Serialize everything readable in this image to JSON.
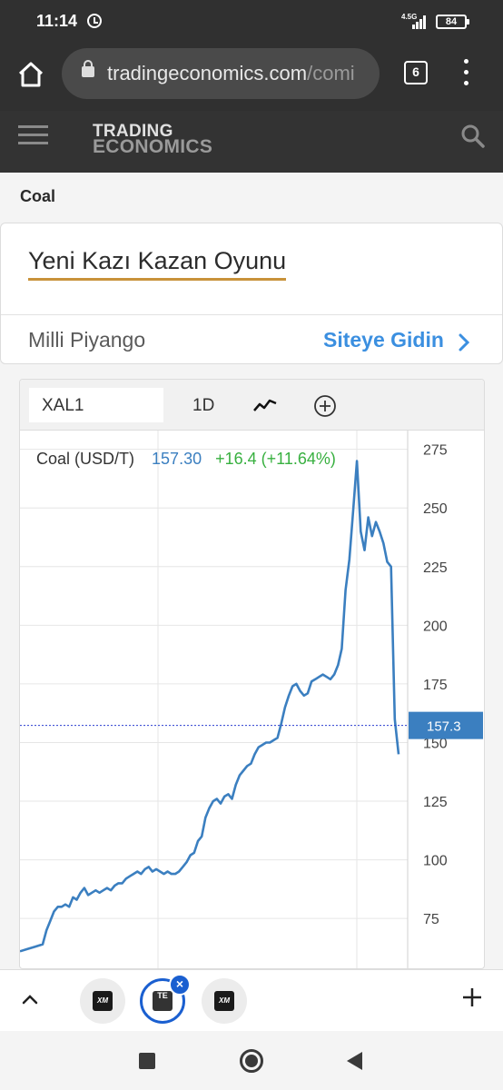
{
  "status_bar": {
    "time": "11:14",
    "network_type": "4.5G",
    "battery_level": "84",
    "icons": [
      "alarm-icon",
      "signal-icon",
      "battery-icon"
    ]
  },
  "browser": {
    "url_main": "tradingeconomics.com",
    "url_rest": "/comi",
    "tab_count": "6",
    "icons": [
      "home-icon",
      "lock-icon",
      "more-vert-icon"
    ]
  },
  "site_header": {
    "logo_line1": "TRADING",
    "logo_line2": "ECONOMICS",
    "icons": [
      "hamburger-icon",
      "search-icon"
    ]
  },
  "page": {
    "title": "Coal"
  },
  "ad": {
    "headline": "Yeni Kazı Kazan Oyunu",
    "advertiser": "Milli Piyango",
    "cta": "Siteye Gidin",
    "accent_color": "#c8923a",
    "cta_color": "#3b8fe0"
  },
  "chart_toolbar": {
    "symbol": "XAL1",
    "interval": "1D",
    "icons": [
      "line-chart-icon",
      "add-indicator-icon"
    ]
  },
  "chart_data": {
    "type": "line",
    "legend_name": "Coal (USD/T)",
    "last_value": "157.30",
    "change": "+16.4 (+11.64%)",
    "current_price_label": "157.3",
    "current_price": 157.3,
    "y_ticks": [
      "275",
      "250",
      "225",
      "200",
      "175",
      "150",
      "125",
      "100",
      "75"
    ],
    "ylim": [
      53,
      283
    ],
    "x": [
      0,
      2,
      4,
      6,
      7,
      8,
      9,
      10,
      11,
      12,
      13,
      14,
      15,
      16,
      17,
      18,
      19,
      20,
      21,
      22,
      23,
      24,
      25,
      26,
      27,
      28,
      29,
      30,
      31,
      32,
      33,
      34,
      35,
      36,
      37,
      38,
      39,
      40,
      41,
      42,
      43,
      44,
      45,
      46,
      47,
      48,
      49,
      50,
      51,
      52,
      53,
      54,
      55,
      56,
      57,
      58,
      59,
      60,
      61,
      62,
      63,
      64,
      65,
      66,
      67,
      68,
      69,
      70,
      71,
      72,
      73,
      74,
      75,
      76,
      77,
      78,
      79,
      80,
      81,
      82,
      83,
      84,
      85,
      86,
      87,
      88,
      89,
      90,
      91,
      92,
      93,
      94,
      95,
      96,
      97,
      98,
      99,
      100
    ],
    "values": [
      61,
      62,
      63,
      64,
      70,
      74,
      78,
      80,
      80,
      81,
      80,
      84,
      83,
      86,
      88,
      85,
      86,
      87,
      86,
      87,
      88,
      87,
      89,
      90,
      90,
      92,
      93,
      94,
      95,
      94,
      96,
      97,
      95,
      96,
      95,
      94,
      95,
      94,
      94,
      95,
      97,
      99,
      102,
      103,
      108,
      110,
      118,
      122,
      125,
      126,
      124,
      127,
      128,
      126,
      132,
      136,
      138,
      140,
      141,
      145,
      148,
      149,
      150,
      150,
      151,
      152,
      158,
      165,
      170,
      174,
      175,
      172,
      170,
      171,
      176,
      177,
      178,
      179,
      178,
      177,
      179,
      183,
      190,
      215,
      228,
      249,
      270,
      240,
      232,
      246,
      238,
      244,
      240,
      235,
      227,
      225,
      160,
      145
    ],
    "colors": {
      "line": "#3b7fc0",
      "change": "#38b040",
      "price_tag": "#3b7fc0"
    }
  },
  "bottom_tabs": {
    "tabs": [
      {
        "favicon": "XM"
      },
      {
        "favicon": "TE",
        "active": true
      },
      {
        "favicon": "XM"
      }
    ],
    "icons": [
      "chevron-up-icon",
      "close-icon",
      "plus-icon"
    ]
  },
  "nav_bar": {
    "icons": [
      "recents-icon",
      "home-circle-icon",
      "back-icon"
    ]
  }
}
